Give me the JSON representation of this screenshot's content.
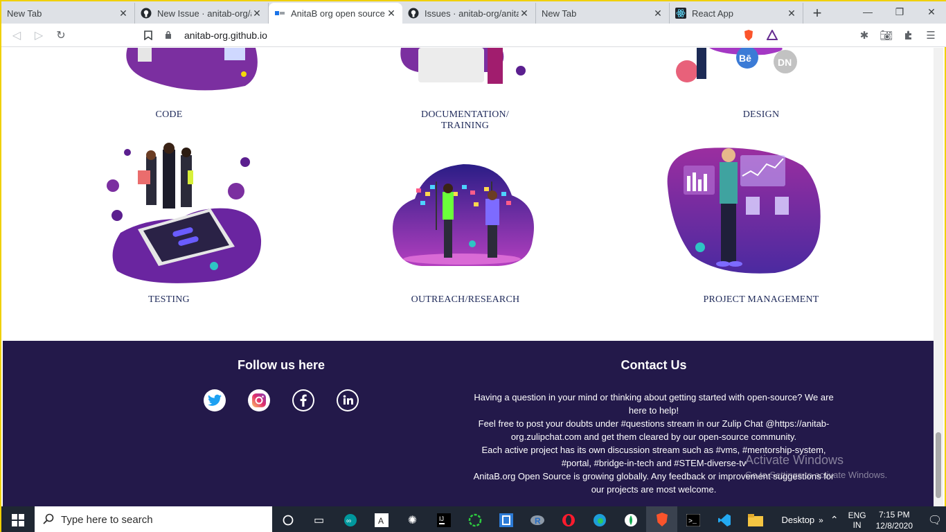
{
  "browser": {
    "tabs": [
      {
        "title": "New Tab",
        "icon": "blank-icon",
        "active": false
      },
      {
        "title": "New Issue · anitab-org/an",
        "icon": "github-icon",
        "active": false
      },
      {
        "title": "AnitaB org open source",
        "icon": "anitab-icon",
        "active": true
      },
      {
        "title": "Issues · anitab-org/anitab",
        "icon": "github-icon",
        "active": false
      },
      {
        "title": "New Tab",
        "icon": "blank-icon",
        "active": false
      },
      {
        "title": "React App",
        "icon": "react-icon",
        "active": false
      }
    ],
    "address": "anitab-org.github.io"
  },
  "areas": {
    "code": "CODE",
    "documentation": "DOCUMENTATION/\nTRAINING",
    "design": "DESIGN",
    "testing": "TESTING",
    "outreach": "OUTREACH/RESEARCH",
    "project_management": "PROJECT MANAGEMENT"
  },
  "footer": {
    "follow_title": "Follow us here",
    "contact_title": "Contact Us",
    "contact_lines": [
      "Having a question in your mind or thinking about getting started with open-source? We are here to help!",
      "Feel free to post your doubts under #questions stream in our Zulip Chat @https://anitab-org.zulipchat.com and get them cleared by our open-source community.",
      "Each active project has its own discussion stream such as #vms, #mentorship-system, #portal, #bridge-in-tech and #STEM-diverse-tv",
      "AnitaB.org Open Source is growing globally. Any feedback or improvement suggestions for our projects are most welcome."
    ],
    "watermark_title": "Activate Windows",
    "watermark_sub": "Go to Settings to activate Windows."
  },
  "taskbar": {
    "search_placeholder": "Type here to search",
    "desktop_label": "Desktop",
    "lang_top": "ENG",
    "lang_bottom": "IN",
    "time": "7:15 PM",
    "date": "12/8/2020"
  },
  "colors": {
    "footer_bg": "#23194a",
    "purple": "#7b2fa0",
    "heading_text": "#1f2a5a"
  }
}
